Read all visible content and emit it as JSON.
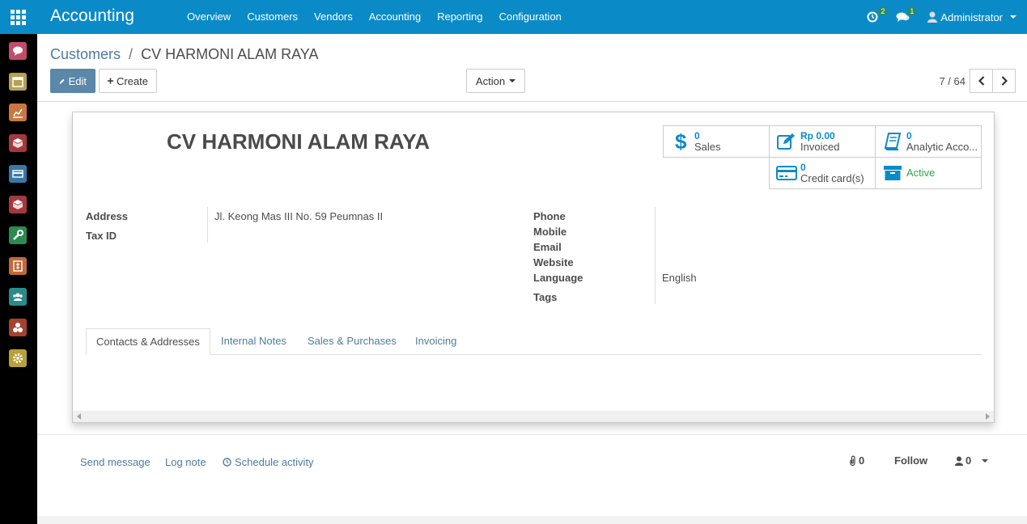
{
  "app": {
    "title": "Accounting"
  },
  "top_menu": [
    "Overview",
    "Customers",
    "Vendors",
    "Accounting",
    "Reporting",
    "Configuration"
  ],
  "systray": {
    "activity_count": "2",
    "messages_count": "1",
    "user_name": "Administrator"
  },
  "sidebar": {
    "apps": [
      {
        "icon": "discuss-icon",
        "color": "#c34b6e"
      },
      {
        "icon": "calendar-icon",
        "color": "#b5a250"
      },
      {
        "icon": "chart-icon",
        "color": "#c97840"
      },
      {
        "icon": "box-icon",
        "color": "#a3393e"
      },
      {
        "icon": "card-icon",
        "color": "#3a77a6"
      },
      {
        "icon": "box2-icon",
        "color": "#a3393e"
      },
      {
        "icon": "wrench-icon",
        "color": "#2b8a4f"
      },
      {
        "icon": "invoice-icon",
        "color": "#c0693a"
      },
      {
        "icon": "people-icon",
        "color": "#2a8c8a"
      },
      {
        "icon": "cubes-icon",
        "color": "#a64030"
      },
      {
        "icon": "settings-icon",
        "color": "#b8a13a"
      }
    ]
  },
  "breadcrumb": {
    "parent": "Customers",
    "separator": "/",
    "current": "CV HARMONI ALAM RAYA"
  },
  "buttons": {
    "edit": "Edit",
    "create": "Create",
    "action": "Action"
  },
  "pager": {
    "value": "7 / 64"
  },
  "partner": {
    "name": "CV HARMONI ALAM RAYA",
    "labels": {
      "address": "Address",
      "tax_id": "Tax ID",
      "phone": "Phone",
      "mobile": "Mobile",
      "email": "Email",
      "website": "Website",
      "language": "Language",
      "tags": "Tags"
    },
    "address_value": "Jl. Keong Mas III No. 59 Peumnas II",
    "language_value": "English"
  },
  "smart_buttons": {
    "sales": {
      "value": "0",
      "label": "Sales"
    },
    "invoiced": {
      "value": "Rp 0.00",
      "label": "Invoiced"
    },
    "analytic": {
      "value": "0",
      "label": "Analytic Acco..."
    },
    "credit": {
      "value": "0",
      "label": "Credit card(s)"
    },
    "active": {
      "label": "Active",
      "color": "#28a745"
    }
  },
  "tabs": [
    "Contacts & Addresses",
    "Internal Notes",
    "Sales & Purchases",
    "Invoicing"
  ],
  "chatter": {
    "send_message": "Send message",
    "log_note": "Log note",
    "schedule_activity": "Schedule activity",
    "attachments_count": "0",
    "follow": "Follow",
    "followers_count": "0"
  }
}
